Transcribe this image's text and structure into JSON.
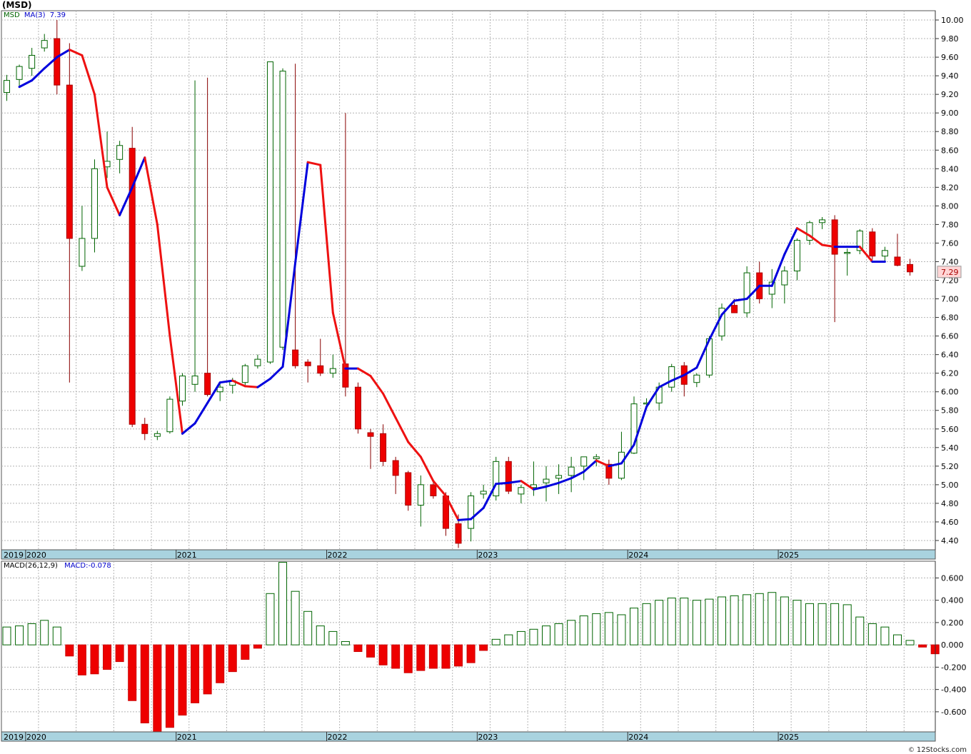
{
  "title": "(MSD)",
  "credit": "12Stocks.com",
  "price_panel": {
    "symbol_label": "MSD",
    "ma_label": "MA(3)",
    "ma_value": "7.39",
    "last_price": "7.29",
    "y_ticks": [
      "4.40",
      "4.60",
      "4.80",
      "5.00",
      "5.20",
      "5.40",
      "5.60",
      "5.80",
      "6.00",
      "6.20",
      "6.40",
      "6.60",
      "6.80",
      "7.00",
      "7.20",
      "7.40",
      "7.60",
      "7.80",
      "8.00",
      "8.20",
      "8.40",
      "8.60",
      "8.80",
      "9.00",
      "9.20",
      "9.40",
      "9.60",
      "9.80",
      "10.00"
    ],
    "x_labels": [
      "2019",
      "2020",
      "2021",
      "2022",
      "2023",
      "2024",
      "2025"
    ]
  },
  "macd_panel": {
    "label": "MACD(26,12,9)",
    "value_label": "MACD:-0.078",
    "y_ticks": [
      "0.600",
      "0.400",
      "0.200",
      "0.000",
      "-0.200",
      "-0.400",
      "-0.600"
    ],
    "x_labels": [
      "2019",
      "2020",
      "2021",
      "2022",
      "2023",
      "2024",
      "2025"
    ]
  },
  "colors": {
    "up_candle": "#006400",
    "down_candle": "#ee0000",
    "ma_up": "#0000dd",
    "ma_down": "#ee1111",
    "grid": "#b4b4b4",
    "axis_band": "#a9d3df",
    "price_box": "#ffd6d6"
  },
  "chart_data": [
    {
      "type": "candlestick",
      "title": "(MSD)",
      "ylim": [
        4.3,
        10.1
      ],
      "grid": true,
      "legend": "top-left",
      "series": [
        {
          "name": "MSD",
          "dates": [
            "2019-11",
            "2019-12",
            "2020-01",
            "2020-02",
            "2020-03",
            "2020-04",
            "2020-05",
            "2020-06",
            "2020-07",
            "2020-08",
            "2020-09",
            "2020-10",
            "2020-11",
            "2020-12",
            "2021-01",
            "2021-02",
            "2021-03",
            "2021-04",
            "2021-05",
            "2021-06",
            "2021-07",
            "2021-08",
            "2021-09",
            "2021-10",
            "2021-11",
            "2021-12",
            "2022-01",
            "2022-02",
            "2022-03",
            "2022-04",
            "2022-05",
            "2022-06",
            "2022-07",
            "2022-08",
            "2022-09",
            "2022-10",
            "2022-11",
            "2022-12",
            "2023-01",
            "2023-02",
            "2023-03",
            "2023-04",
            "2023-05",
            "2023-06",
            "2023-07",
            "2023-08",
            "2023-09",
            "2023-10",
            "2023-11",
            "2023-12",
            "2024-01",
            "2024-02",
            "2024-03",
            "2024-04",
            "2024-05",
            "2024-06",
            "2024-07",
            "2024-08",
            "2024-09",
            "2024-10",
            "2024-11",
            "2024-12",
            "2025-01",
            "2025-02",
            "2025-03",
            "2025-04",
            "2025-05",
            "2025-06",
            "2025-07",
            "2025-08",
            "2025-09",
            "2025-10",
            "2025-11"
          ],
          "ohlc": [
            [
              9.22,
              9.41,
              9.13,
              9.35
            ],
            [
              9.36,
              9.52,
              9.28,
              9.5
            ],
            [
              9.48,
              9.7,
              9.4,
              9.62
            ],
            [
              9.7,
              9.85,
              9.66,
              9.78
            ],
            [
              9.8,
              10.0,
              9.2,
              9.3
            ],
            [
              9.3,
              9.75,
              6.1,
              7.65
            ],
            [
              7.35,
              8.0,
              7.3,
              7.65
            ],
            [
              7.65,
              8.5,
              7.5,
              8.4
            ],
            [
              8.42,
              8.8,
              8.3,
              8.48
            ],
            [
              8.5,
              8.7,
              8.35,
              8.65
            ],
            [
              8.62,
              8.85,
              5.62,
              5.65
            ],
            [
              5.65,
              5.72,
              5.48,
              5.55
            ],
            [
              5.52,
              5.58,
              5.48,
              5.55
            ],
            [
              5.57,
              5.95,
              5.55,
              5.92
            ],
            [
              5.9,
              6.2,
              5.85,
              6.17
            ],
            [
              6.08,
              9.35,
              6.0,
              6.17
            ],
            [
              6.2,
              9.38,
              5.95,
              5.97
            ],
            [
              6.0,
              6.08,
              5.9,
              6.05
            ],
            [
              6.07,
              6.15,
              5.98,
              6.12
            ],
            [
              6.1,
              6.3,
              6.05,
              6.28
            ],
            [
              6.28,
              6.4,
              6.25,
              6.35
            ],
            [
              6.32,
              9.55,
              6.3,
              9.55
            ],
            [
              6.48,
              9.48,
              6.45,
              9.45
            ],
            [
              6.45,
              9.53,
              6.25,
              6.28
            ],
            [
              6.32,
              6.35,
              6.1,
              6.28
            ],
            [
              6.28,
              6.57,
              6.17,
              6.2
            ],
            [
              6.2,
              6.4,
              6.15,
              6.25
            ],
            [
              6.3,
              9.0,
              5.95,
              6.05
            ],
            [
              6.05,
              6.1,
              5.55,
              5.6
            ],
            [
              5.56,
              5.6,
              5.17,
              5.52
            ],
            [
              5.55,
              5.65,
              5.2,
              5.25
            ],
            [
              5.26,
              5.3,
              4.9,
              5.1
            ],
            [
              5.13,
              5.15,
              4.72,
              4.78
            ],
            [
              4.78,
              5.1,
              4.55,
              5.0
            ],
            [
              5.0,
              5.03,
              4.85,
              4.88
            ],
            [
              4.88,
              4.92,
              4.45,
              4.53
            ],
            [
              4.58,
              4.68,
              4.32,
              4.37
            ],
            [
              4.53,
              4.92,
              4.39,
              4.88
            ],
            [
              4.9,
              5.0,
              4.85,
              4.93
            ],
            [
              4.88,
              5.3,
              4.83,
              5.25
            ],
            [
              5.25,
              5.3,
              4.9,
              4.93
            ],
            [
              4.9,
              5.0,
              4.8,
              4.97
            ],
            [
              4.97,
              5.25,
              4.88,
              5.0
            ],
            [
              5.02,
              5.2,
              4.82,
              5.06
            ],
            [
              5.07,
              5.22,
              4.9,
              5.1
            ],
            [
              5.1,
              5.3,
              4.92,
              5.19
            ],
            [
              5.2,
              5.28,
              5.05,
              5.3
            ],
            [
              5.28,
              5.33,
              5.2,
              5.3
            ],
            [
              5.22,
              5.27,
              5.0,
              5.07
            ],
            [
              5.07,
              5.57,
              5.05,
              5.35
            ],
            [
              5.34,
              5.95,
              5.33,
              5.87
            ],
            [
              5.87,
              5.93,
              5.82,
              5.88
            ],
            [
              5.88,
              6.1,
              5.8,
              6.05
            ],
            [
              6.05,
              6.3,
              6.0,
              6.27
            ],
            [
              6.28,
              6.32,
              5.95,
              6.08
            ],
            [
              6.1,
              6.2,
              6.05,
              6.18
            ],
            [
              6.18,
              6.6,
              6.15,
              6.57
            ],
            [
              6.6,
              6.95,
              6.55,
              6.9
            ],
            [
              6.93,
              7.0,
              6.85,
              6.85
            ],
            [
              6.85,
              7.35,
              6.8,
              7.28
            ],
            [
              7.28,
              7.4,
              6.95,
              7.0
            ],
            [
              7.05,
              7.32,
              6.9,
              7.18
            ],
            [
              7.15,
              7.35,
              6.95,
              7.3
            ],
            [
              7.3,
              7.65,
              7.2,
              7.63
            ],
            [
              7.63,
              7.84,
              7.58,
              7.82
            ],
            [
              7.82,
              7.88,
              7.75,
              7.85
            ],
            [
              7.85,
              7.9,
              6.75,
              7.48
            ],
            [
              7.5,
              7.54,
              7.25,
              7.5
            ],
            [
              7.52,
              7.75,
              7.48,
              7.73
            ],
            [
              7.72,
              7.76,
              7.42,
              7.46
            ],
            [
              7.46,
              7.56,
              7.4,
              7.52
            ],
            [
              7.45,
              7.7,
              7.35,
              7.36
            ],
            [
              7.37,
              7.43,
              7.25,
              7.29
            ]
          ]
        },
        {
          "name": "MA(3)",
          "values": [
            9.28,
            9.35,
            9.48,
            9.6,
            9.68,
            9.62,
            9.2,
            8.2,
            7.9,
            8.2,
            8.52,
            7.8,
            6.6,
            5.55,
            5.66,
            5.88,
            6.1,
            6.12,
            6.06,
            6.05,
            6.14,
            6.27,
            7.39,
            8.47,
            8.44,
            6.85,
            6.25,
            6.25,
            6.17,
            5.98,
            5.72,
            5.46,
            5.3,
            5.04,
            4.88,
            4.62,
            4.63,
            4.75,
            5.01,
            5.02,
            5.04,
            4.95,
            4.98,
            5.02,
            5.07,
            5.14,
            5.26,
            5.2,
            5.23,
            5.43,
            5.84,
            6.05,
            6.12,
            6.18,
            6.26,
            6.56,
            6.83,
            6.98,
            7.0,
            7.14,
            7.14,
            7.48,
            7.76,
            7.68,
            7.58,
            7.56,
            7.56,
            7.56,
            7.4,
            7.4
          ],
          "start_index": 1
        }
      ]
    },
    {
      "type": "bar",
      "title": "MACD(26,12,9)",
      "ylim": [
        -0.78,
        0.75
      ],
      "grid": true,
      "series": [
        {
          "name": "MACD",
          "values": [
            0.16,
            0.17,
            0.19,
            0.22,
            0.16,
            -0.1,
            -0.27,
            -0.26,
            -0.22,
            -0.15,
            -0.5,
            -0.7,
            -0.78,
            -0.74,
            -0.63,
            -0.52,
            -0.44,
            -0.34,
            -0.24,
            -0.13,
            -0.03,
            0.46,
            0.74,
            0.48,
            0.3,
            0.17,
            0.12,
            0.03,
            -0.06,
            -0.11,
            -0.18,
            -0.21,
            -0.25,
            -0.23,
            -0.21,
            -0.21,
            -0.19,
            -0.16,
            -0.05,
            0.05,
            0.09,
            0.12,
            0.14,
            0.17,
            0.19,
            0.22,
            0.26,
            0.28,
            0.29,
            0.27,
            0.33,
            0.37,
            0.4,
            0.42,
            0.42,
            0.4,
            0.41,
            0.43,
            0.44,
            0.45,
            0.46,
            0.47,
            0.43,
            0.4,
            0.37,
            0.37,
            0.37,
            0.36,
            0.25,
            0.19,
            0.16,
            0.09,
            0.04,
            -0.02,
            -0.08
          ]
        }
      ]
    }
  ]
}
